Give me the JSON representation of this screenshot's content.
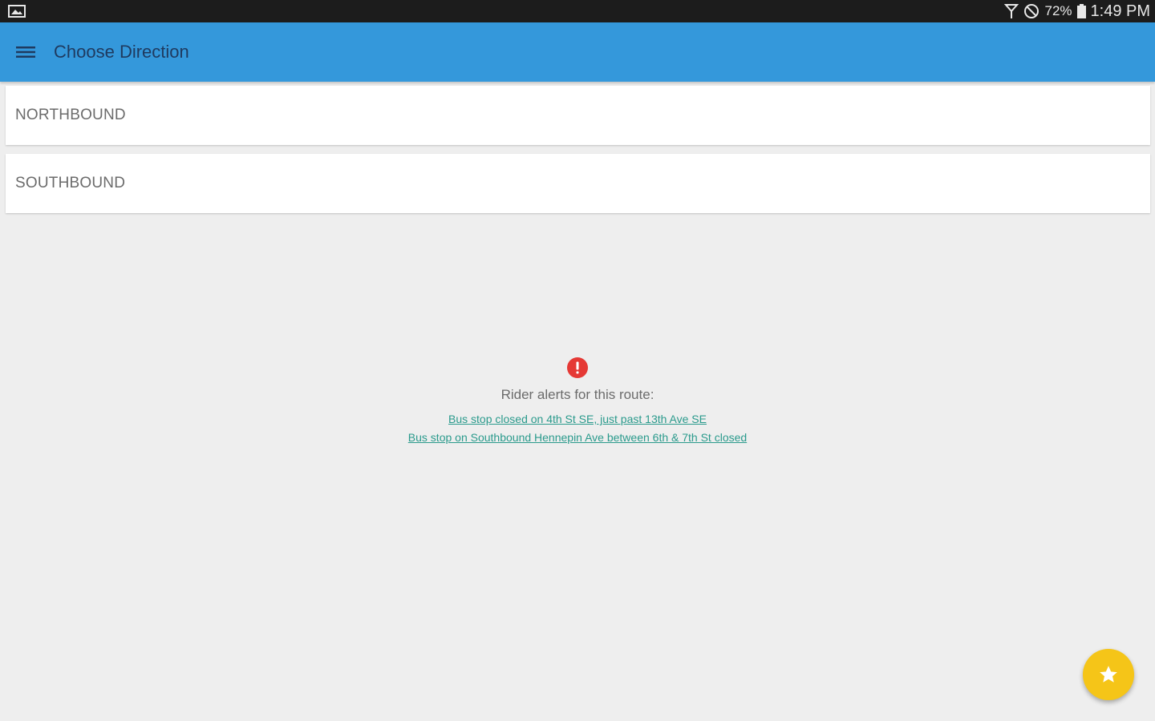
{
  "status_bar": {
    "battery": "72%",
    "time": "1:49 PM",
    "icons": [
      "image-icon",
      "signal-icon",
      "do-not-disturb-icon",
      "battery-icon"
    ]
  },
  "app_bar": {
    "title": "Choose Direction",
    "menu_icon": "hamburger-menu-icon"
  },
  "directions": [
    {
      "label": "NORTHBOUND"
    },
    {
      "label": "SOUTHBOUND"
    }
  ],
  "alerts": {
    "icon": "alert-icon",
    "heading": "Rider alerts for this route:",
    "links": [
      "Bus stop closed on 4th St SE, just past 13th Ave SE",
      "Bus stop on Southbound Hennepin Ave between 6th & 7th St closed"
    ]
  },
  "fab": {
    "icon": "star-icon"
  },
  "colors": {
    "status_bar": "#1c1c1c",
    "app_bar": "#3498db",
    "title_text": "#1f3a5f",
    "background": "#eeeeee",
    "link": "#2a9a8c",
    "alert": "#e53935",
    "fab": "#f5c518"
  }
}
